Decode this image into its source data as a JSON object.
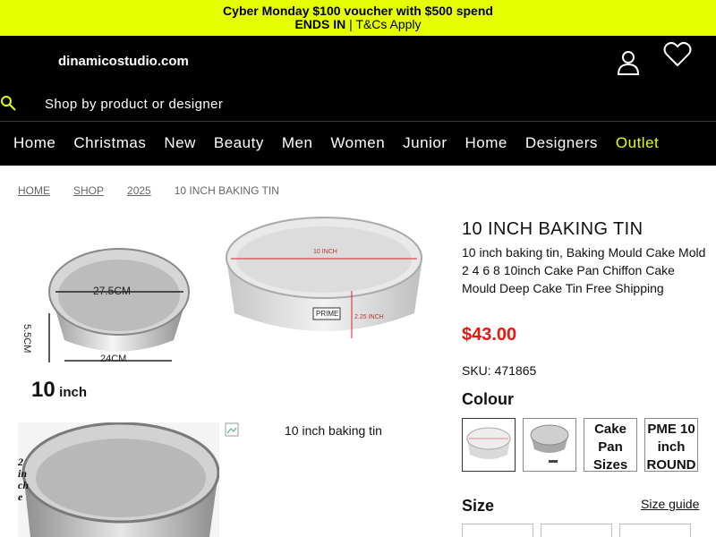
{
  "promo": {
    "line1": "Cyber Monday $100 voucher with $500 spend",
    "ends_in": "ENDS IN",
    "tcs": " | T&Cs Apply"
  },
  "header": {
    "logo": "dinamicostudio.com",
    "search_placeholder": "Shop by product or designer"
  },
  "nav": {
    "items": [
      "Home",
      "Christmas",
      "New",
      "Beauty",
      "Men",
      "Women",
      "Junior",
      "Home",
      "Designers",
      "Outlet"
    ]
  },
  "breadcrumb": [
    "HOME",
    "SHOP",
    "2025",
    "10 INCH BAKING TIN"
  ],
  "product": {
    "title": "10 INCH BAKING TIN",
    "description": "10 inch baking tin, Baking Mould Cake Mold 2 4 6 8 10inch Cake Pan Chiffon Cake Mould Deep Cake Tin Free Shipping",
    "price": "$43.00",
    "sku": "SKU: 471865",
    "colour_label": "Colour",
    "size_label": "Size",
    "size_guide": "Size guide"
  },
  "images": {
    "img1": {
      "diameter": "27.5CM",
      "height": "5.5CM",
      "base": "24CM",
      "size_num": "10",
      "size_unit": "inch"
    },
    "img2": {
      "width": "10 INCH",
      "height": "2.25 INCH",
      "brand": "PRIME"
    },
    "img3": {
      "side": "2 inche"
    },
    "img4_alt": "10 inch baking tin"
  },
  "swatches": [
    {
      "type": "image",
      "label": ""
    },
    {
      "type": "image",
      "label": ""
    },
    {
      "type": "alt",
      "label": "Cake Pan Sizes"
    },
    {
      "type": "alt",
      "label": "PME 10 inch ROUND"
    }
  ],
  "colors": {
    "accent": "#e5ff00",
    "price": "#e8170f",
    "header_bg": "#000000"
  }
}
